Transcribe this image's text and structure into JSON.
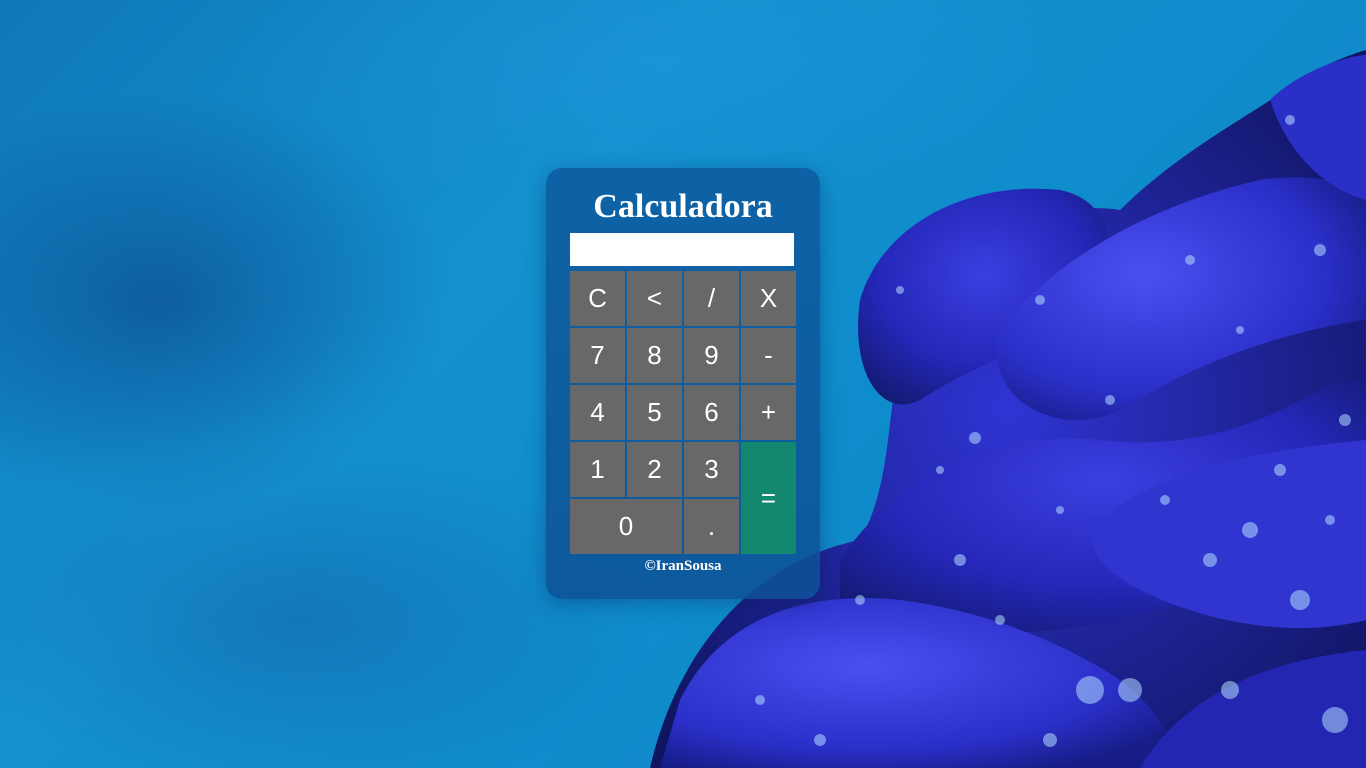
{
  "calculator": {
    "title": "Calculadora",
    "display_value": "",
    "credit": "©IranSousa",
    "keys": {
      "clear": "C",
      "backspace": "<",
      "divide": "/",
      "multiply": "X",
      "seven": "7",
      "eight": "8",
      "nine": "9",
      "minus": "-",
      "four": "4",
      "five": "5",
      "six": "6",
      "plus": "+",
      "one": "1",
      "two": "2",
      "three": "3",
      "equals": "=",
      "zero": "0",
      "decimal": "."
    }
  },
  "colors": {
    "key_background": "#686868",
    "equals_background": "#14876f",
    "card_background": "#0c5ca0",
    "display_background": "#ffffff"
  },
  "background": {
    "subject": "blue-rose-with-water-drops"
  }
}
